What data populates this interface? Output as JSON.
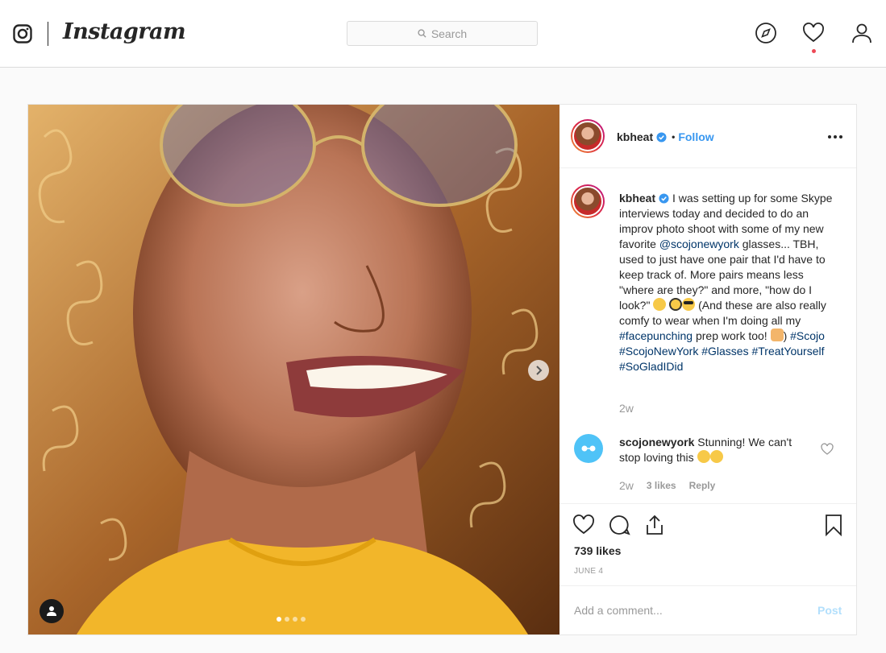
{
  "nav": {
    "brand": "Instagram",
    "search_placeholder": "Search",
    "icons": [
      "instagram-glyph-icon",
      "compass-icon",
      "heart-icon",
      "profile-icon"
    ]
  },
  "post": {
    "username": "kbheat",
    "follow_label": "Follow",
    "bullet": "•",
    "caption": {
      "username": "kbheat",
      "text_1": "I was setting up for some Skype interviews today and decided to do an improv photo shoot with some of my new favorite",
      "mention": "@scojonewyork",
      "text_2": "glasses... TBH, used to just have one pair that I'd have to keep track of. More pairs means less \"where are they?\" and more, \"how do I look?\"",
      "text_3": "(And these are also really comfy to wear when I'm doing all my",
      "hashtag_1": "#facepunching",
      "text_4": "prep work too!",
      "text_5": ")",
      "hashtags": [
        "#Scojo",
        "#ScojoNewYork",
        "#Glasses",
        "#TreatYourself",
        "#SoGladIDid"
      ],
      "time": "2w"
    },
    "comment": {
      "username": "scojonewyork",
      "text": "Stunning! We can't stop loving this",
      "time": "2w",
      "likes": "3 likes",
      "reply": "Reply"
    },
    "likes": "739 likes",
    "date": "JUNE 4",
    "add_comment_placeholder": "Add a comment...",
    "post_button": "Post",
    "carousel": {
      "count": 4,
      "active": 0
    }
  },
  "colors": {
    "link": "#3897f0",
    "hashtag": "#003569",
    "border": "#dbdbdb",
    "notification": "#ed4956"
  }
}
